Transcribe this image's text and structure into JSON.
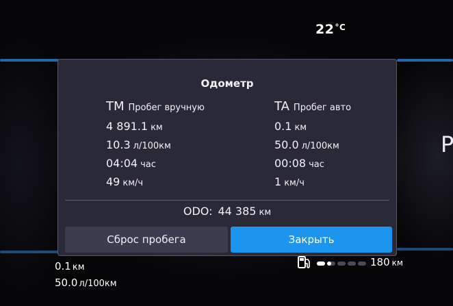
{
  "cluster": {
    "temperature": "22",
    "temperature_unit": "°C",
    "side_letter": "P"
  },
  "dialog": {
    "title": "Одометр",
    "tm": {
      "code": "TM",
      "name": "Пробег вручную",
      "distance": "4 891.1",
      "distance_unit": "км",
      "consumption": "10.3",
      "consumption_unit": "л/100км",
      "time": "04:04",
      "time_unit": "час",
      "speed": "49",
      "speed_unit": "км/ч"
    },
    "ta": {
      "code": "TA",
      "name": "Пробег авто",
      "distance": "0.1",
      "distance_unit": "км",
      "consumption": "50.0",
      "consumption_unit": "л/100км",
      "time": "00:08",
      "time_unit": "час",
      "speed": "1",
      "speed_unit": "км/ч"
    },
    "odo_label": "ODO:",
    "odo_value": "44 385",
    "odo_unit": "км",
    "reset_label": "Сброс пробега",
    "close_label": "Закрыть"
  },
  "bottom": {
    "trip_distance": "0.1",
    "trip_distance_unit": "км",
    "trip_consumption": "50.0",
    "trip_consumption_unit": "л/100км",
    "range_value": "180",
    "range_unit": "км",
    "fuel_level_fraction": 0.3,
    "fuel_segments": 5,
    "fuel_icon": "fuel-pump-icon"
  },
  "colors": {
    "accent": "#1d95ee",
    "dialog_bg": "#2a2938",
    "edge_blue": "#2d7fd8"
  }
}
